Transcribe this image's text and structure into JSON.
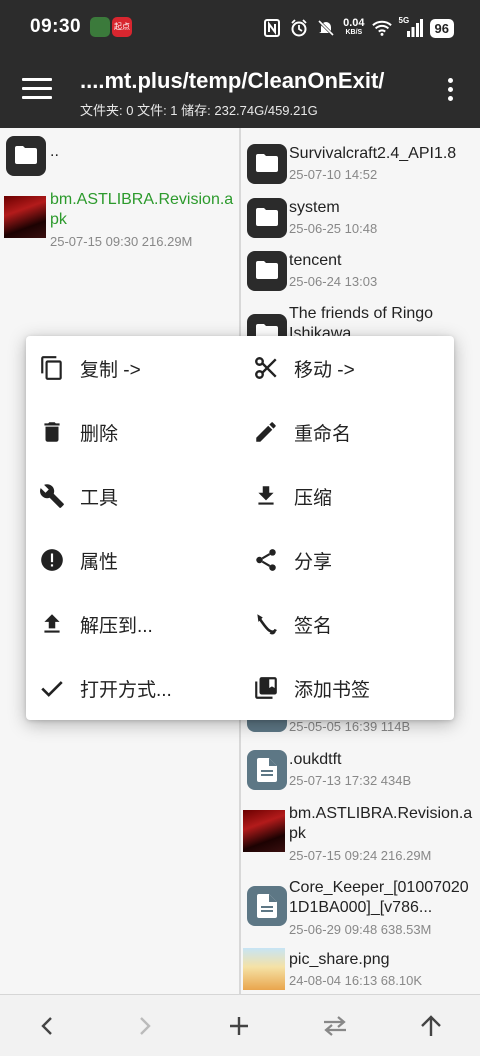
{
  "status": {
    "time": "09:30",
    "app1": "",
    "app2": "起点",
    "speed_value": "0.04",
    "speed_unit": "KB/S",
    "network": "5G",
    "battery": "96"
  },
  "header": {
    "path": "....mt.plus/temp/CleanOnExit/",
    "info": "文件夹: 0  文件: 1  储存: 232.74G/459.21G"
  },
  "left_pane": {
    "parent_label": "..",
    "files": [
      {
        "name": "bm.ASTLIBRA.Revision.apk",
        "meta": "25-07-15 09:30  216.29M"
      }
    ]
  },
  "right_pane": {
    "top_items": [
      {
        "name": "Survivalcraft2.4_API1.8",
        "meta": "25-07-10 14:52"
      },
      {
        "name": "system",
        "meta": "25-06-25 10:48"
      },
      {
        "name": "tencent",
        "meta": "25-06-24 13:03"
      },
      {
        "name": "The friends of Ringo Ishikawa",
        "meta": ""
      }
    ],
    "partial_meta": "25-05-05 16:39  114B",
    "bottom_items": [
      {
        "name": ".oukdtft",
        "meta": "25-07-13 17:32  434B",
        "icon": "file"
      },
      {
        "name": "bm.ASTLIBRA.Revision.apk",
        "meta": "25-07-15 09:24  216.29M",
        "icon": "game"
      },
      {
        "name": "Core_Keeper_[010070201D1BA000]_[v786...",
        "meta": "25-06-29 09:48  638.53M",
        "icon": "file"
      },
      {
        "name": "pic_share.png",
        "meta": "24-08-04 16:13  68.10K",
        "icon": "pic"
      }
    ]
  },
  "menu": {
    "items": [
      {
        "label": "复制 ->",
        "icon": "copy-icon"
      },
      {
        "label": "移动 ->",
        "icon": "scissors-icon"
      },
      {
        "label": "删除",
        "icon": "trash-icon"
      },
      {
        "label": "重命名",
        "icon": "pencil-icon"
      },
      {
        "label": "工具",
        "icon": "wrench-icon"
      },
      {
        "label": "压缩",
        "icon": "download-icon"
      },
      {
        "label": "属性",
        "icon": "info-icon"
      },
      {
        "label": "分享",
        "icon": "share-icon"
      },
      {
        "label": "解压到...",
        "icon": "upload-icon"
      },
      {
        "label": "签名",
        "icon": "signature-icon"
      },
      {
        "label": "打开方式...",
        "icon": "check-icon"
      },
      {
        "label": "添加书签",
        "icon": "bookmark-icon"
      }
    ]
  },
  "toolbar": {
    "back": "back-icon",
    "forward": "forward-icon",
    "add": "plus-icon",
    "swap": "swap-icon",
    "up": "up-arrow-icon"
  },
  "colors": {
    "header_bg": "#2c2c2c",
    "green_name": "#2c9a2c",
    "folder_bg": "#2b2b2b",
    "file_bg": "#5d7785"
  }
}
